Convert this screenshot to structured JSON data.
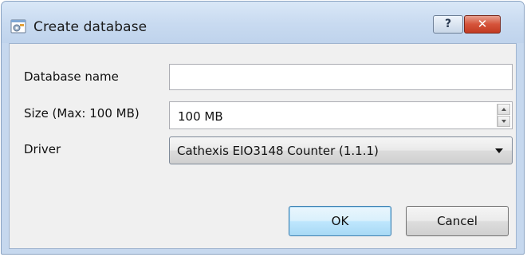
{
  "window": {
    "title": "Create database",
    "help_glyph": "?",
    "close_glyph": "✕",
    "accent_color": "#c6d8ee",
    "close_color": "#c13a22",
    "app_icon": "database-settings-icon"
  },
  "form": {
    "db_name": {
      "label": "Database name",
      "value": ""
    },
    "size": {
      "label": "Size (Max: 100 MB)",
      "value": "100 MB"
    },
    "driver": {
      "label": "Driver",
      "value": "Cathexis EIO3148 Counter (1.1.1)"
    }
  },
  "buttons": {
    "ok": "OK",
    "cancel": "Cancel"
  }
}
